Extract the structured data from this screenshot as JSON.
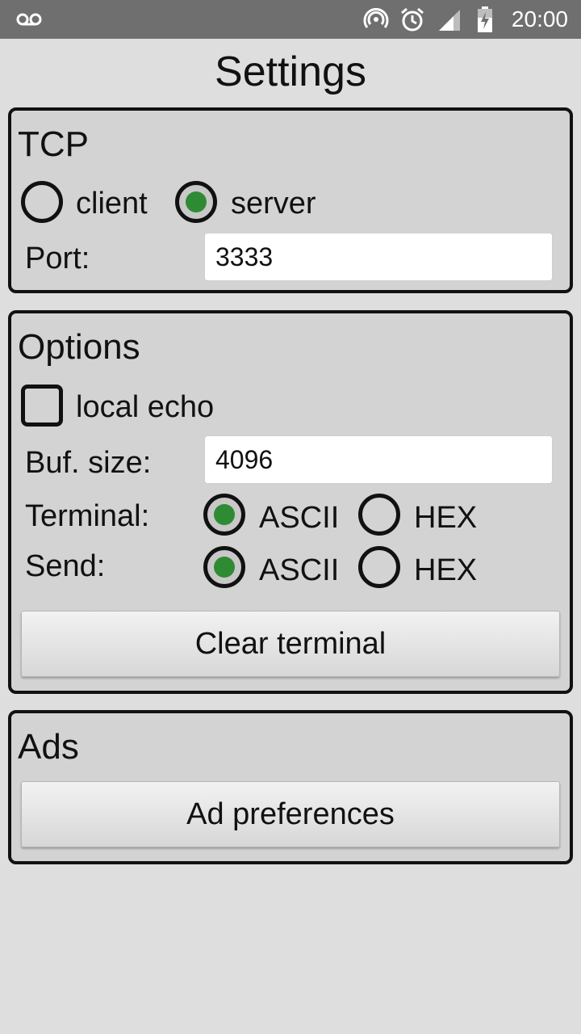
{
  "status_bar": {
    "time": "20:00",
    "icons": [
      "voicemail-icon",
      "hotspot-icon",
      "alarm-icon",
      "signal-icon",
      "battery-charging-icon"
    ]
  },
  "page_title": "Settings",
  "tcp": {
    "title": "TCP",
    "mode_options": [
      {
        "label": "client",
        "selected": false
      },
      {
        "label": "server",
        "selected": true
      }
    ],
    "port_label": "Port:",
    "port_value": "3333"
  },
  "options": {
    "title": "Options",
    "local_echo_label": "local echo",
    "local_echo_checked": false,
    "buf_size_label": "Buf. size:",
    "buf_size_value": "4096",
    "terminal_label": "Terminal:",
    "terminal_options": [
      {
        "label": "ASCII",
        "selected": true
      },
      {
        "label": "HEX",
        "selected": false
      }
    ],
    "send_label": "Send:",
    "send_options": [
      {
        "label": "ASCII",
        "selected": true
      },
      {
        "label": "HEX",
        "selected": false
      }
    ],
    "clear_button": "Clear terminal"
  },
  "ads": {
    "title": "Ads",
    "preferences_button": "Ad preferences"
  },
  "colors": {
    "status_bar": "#6f6f6f",
    "background": "#dedede",
    "panel": "#d3d3d3",
    "radio_selected": "#2e8b34"
  }
}
